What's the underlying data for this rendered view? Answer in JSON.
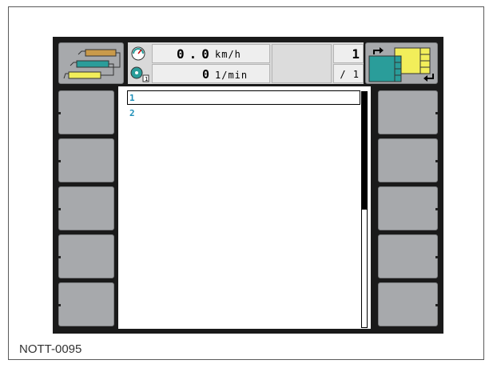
{
  "caption": "NOTT-0095",
  "status": {
    "speed_value": "0.0",
    "speed_unit": "km/h",
    "rpm_value": "0",
    "rpm_unit": "1/min",
    "counter_top": "1",
    "counter_bottom": "/ 1",
    "speedometer_icon": "speedometer-icon",
    "pto_icon": "pto-speed-icon"
  },
  "list": {
    "items": [
      {
        "label": "1",
        "selected": true
      },
      {
        "label": "2",
        "selected": false
      }
    ]
  },
  "scrollbar": {
    "visible_fraction": 0.5
  },
  "colors": {
    "accent": "#1e8fb8",
    "softkey": "#a7a9ac",
    "teal": "#2a9d9a",
    "yellow": "#f2ee5a",
    "orange": "#c99a4a"
  }
}
